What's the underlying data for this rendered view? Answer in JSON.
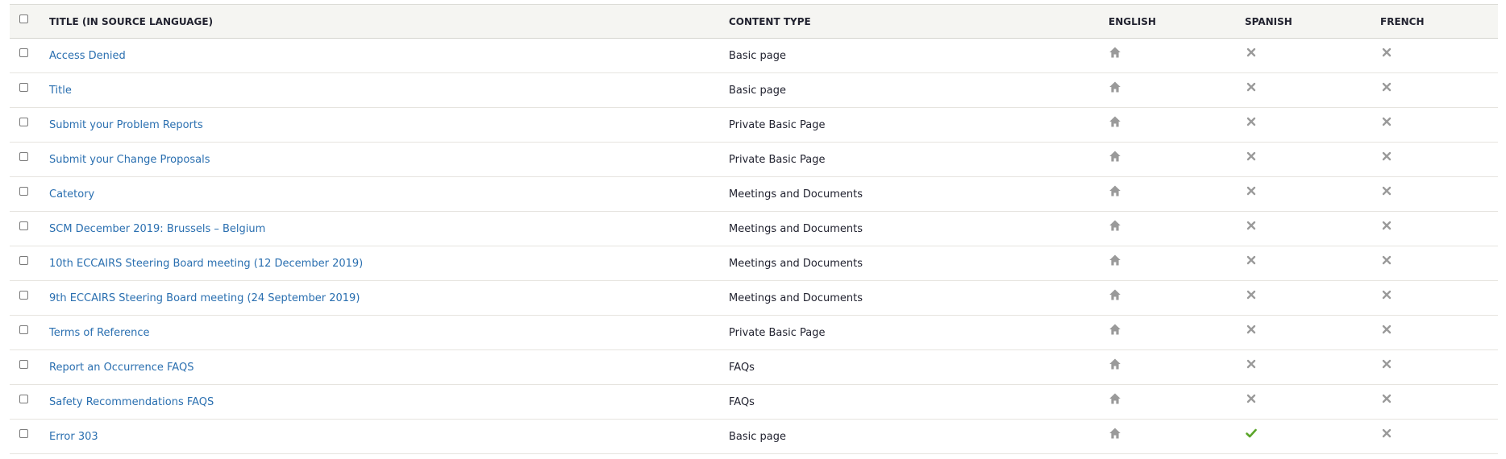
{
  "table": {
    "headers": {
      "title": "Title (in source language)",
      "content_type": "Content type",
      "english": "English",
      "spanish": "Spanish",
      "french": "French"
    },
    "rows": [
      {
        "title": "Access Denied",
        "content_type": "Basic page",
        "english": "source-home-icon",
        "spanish": "not-translated-icon",
        "french": "not-translated-icon"
      },
      {
        "title": "Title",
        "content_type": "Basic page",
        "english": "source-home-icon",
        "spanish": "not-translated-icon",
        "french": "not-translated-icon"
      },
      {
        "title": "Submit your Problem Reports",
        "content_type": "Private Basic Page",
        "english": "source-home-icon",
        "spanish": "not-translated-icon",
        "french": "not-translated-icon"
      },
      {
        "title": "Submit your Change Proposals",
        "content_type": "Private Basic Page",
        "english": "source-home-icon",
        "spanish": "not-translated-icon",
        "french": "not-translated-icon"
      },
      {
        "title": "Catetory",
        "content_type": "Meetings and Documents",
        "english": "source-home-icon",
        "spanish": "not-translated-icon",
        "french": "not-translated-icon"
      },
      {
        "title": "SCM December 2019: Brussels – Belgium",
        "content_type": "Meetings and Documents",
        "english": "source-home-icon",
        "spanish": "not-translated-icon",
        "french": "not-translated-icon"
      },
      {
        "title": "10th ECCAIRS Steering Board meeting (12 December 2019)",
        "content_type": "Meetings and Documents",
        "english": "source-home-icon",
        "spanish": "not-translated-icon",
        "french": "not-translated-icon"
      },
      {
        "title": "9th ECCAIRS Steering Board meeting (24 September 2019)",
        "content_type": "Meetings and Documents",
        "english": "source-home-icon",
        "spanish": "not-translated-icon",
        "french": "not-translated-icon"
      },
      {
        "title": "Terms of Reference",
        "content_type": "Private Basic Page",
        "english": "source-home-icon",
        "spanish": "not-translated-icon",
        "french": "not-translated-icon"
      },
      {
        "title": "Report an Occurrence FAQS",
        "content_type": "FAQs",
        "english": "source-home-icon",
        "spanish": "not-translated-icon",
        "french": "not-translated-icon"
      },
      {
        "title": "Safety Recommendations FAQS",
        "content_type": "FAQs",
        "english": "source-home-icon",
        "spanish": "not-translated-icon",
        "french": "not-translated-icon"
      },
      {
        "title": "Error 303",
        "content_type": "Basic page",
        "english": "source-home-icon",
        "spanish": "translated-check-icon",
        "french": "not-translated-icon"
      }
    ]
  },
  "colors": {
    "link": "#2a6fb0",
    "icon_gray": "#9a9a9a",
    "check_green": "#5ba52a",
    "header_bg": "#f5f5f2"
  }
}
